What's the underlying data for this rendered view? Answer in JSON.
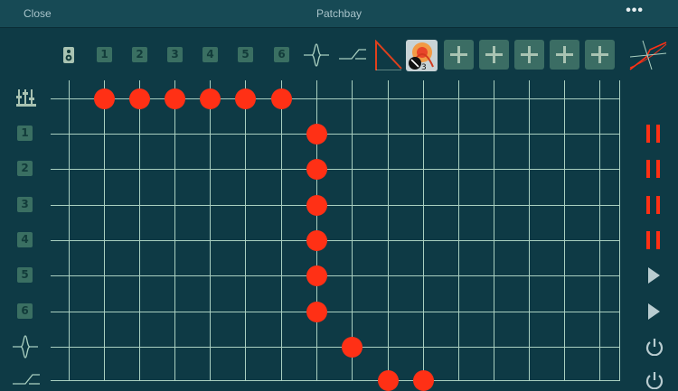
{
  "topbar": {
    "close_label": "Close",
    "title": "Patchbay",
    "more_label": "•••"
  },
  "columns": [
    {
      "id": "speaker",
      "icon": "speaker-icon"
    },
    {
      "id": "ch1",
      "label": "1"
    },
    {
      "id": "ch2",
      "label": "2"
    },
    {
      "id": "ch3",
      "label": "3"
    },
    {
      "id": "ch4",
      "label": "4"
    },
    {
      "id": "ch5",
      "label": "5"
    },
    {
      "id": "ch6",
      "label": "6"
    },
    {
      "id": "filter",
      "icon": "filter-icon"
    },
    {
      "id": "highpass",
      "icon": "highpass-icon"
    },
    {
      "id": "envelope",
      "icon": "envelope-icon"
    },
    {
      "id": "app",
      "icon": "app-icon"
    },
    {
      "id": "add1",
      "icon": "plus-icon"
    },
    {
      "id": "add2",
      "icon": "plus-icon"
    },
    {
      "id": "add3",
      "icon": "plus-icon"
    },
    {
      "id": "add4",
      "icon": "plus-icon"
    },
    {
      "id": "add5",
      "icon": "plus-icon"
    }
  ],
  "rows": [
    {
      "id": "mixer",
      "icon": "mixer-icon",
      "control": "none"
    },
    {
      "id": "ch1",
      "label": "1",
      "control": "pause"
    },
    {
      "id": "ch2",
      "label": "2",
      "control": "pause"
    },
    {
      "id": "ch3",
      "label": "3",
      "control": "pause"
    },
    {
      "id": "ch4",
      "label": "4",
      "control": "pause"
    },
    {
      "id": "ch5",
      "label": "5",
      "control": "play"
    },
    {
      "id": "ch6",
      "label": "6",
      "control": "play"
    },
    {
      "id": "filter",
      "icon": "filter-icon",
      "control": "power"
    },
    {
      "id": "highpass",
      "icon": "highpass-icon",
      "control": "power"
    }
  ],
  "connections": [
    {
      "row": 0,
      "col": 1
    },
    {
      "row": 0,
      "col": 2
    },
    {
      "row": 0,
      "col": 3
    },
    {
      "row": 0,
      "col": 4
    },
    {
      "row": 0,
      "col": 5
    },
    {
      "row": 0,
      "col": 6
    },
    {
      "row": 1,
      "col": 7
    },
    {
      "row": 2,
      "col": 7
    },
    {
      "row": 3,
      "col": 7
    },
    {
      "row": 4,
      "col": 7
    },
    {
      "row": 5,
      "col": 7
    },
    {
      "row": 6,
      "col": 7
    },
    {
      "row": 7,
      "col": 8
    },
    {
      "row": 8,
      "col": 9
    },
    {
      "row": 8,
      "col": 10
    }
  ],
  "colors": {
    "background": "#0e3a45",
    "grid": "#a9cfc0",
    "dot": "#ff3015",
    "button": "#a9c3b2",
    "control_red": "#ff3015",
    "control_light": "#b9ccd0"
  },
  "corner_icon": "curve-icon"
}
